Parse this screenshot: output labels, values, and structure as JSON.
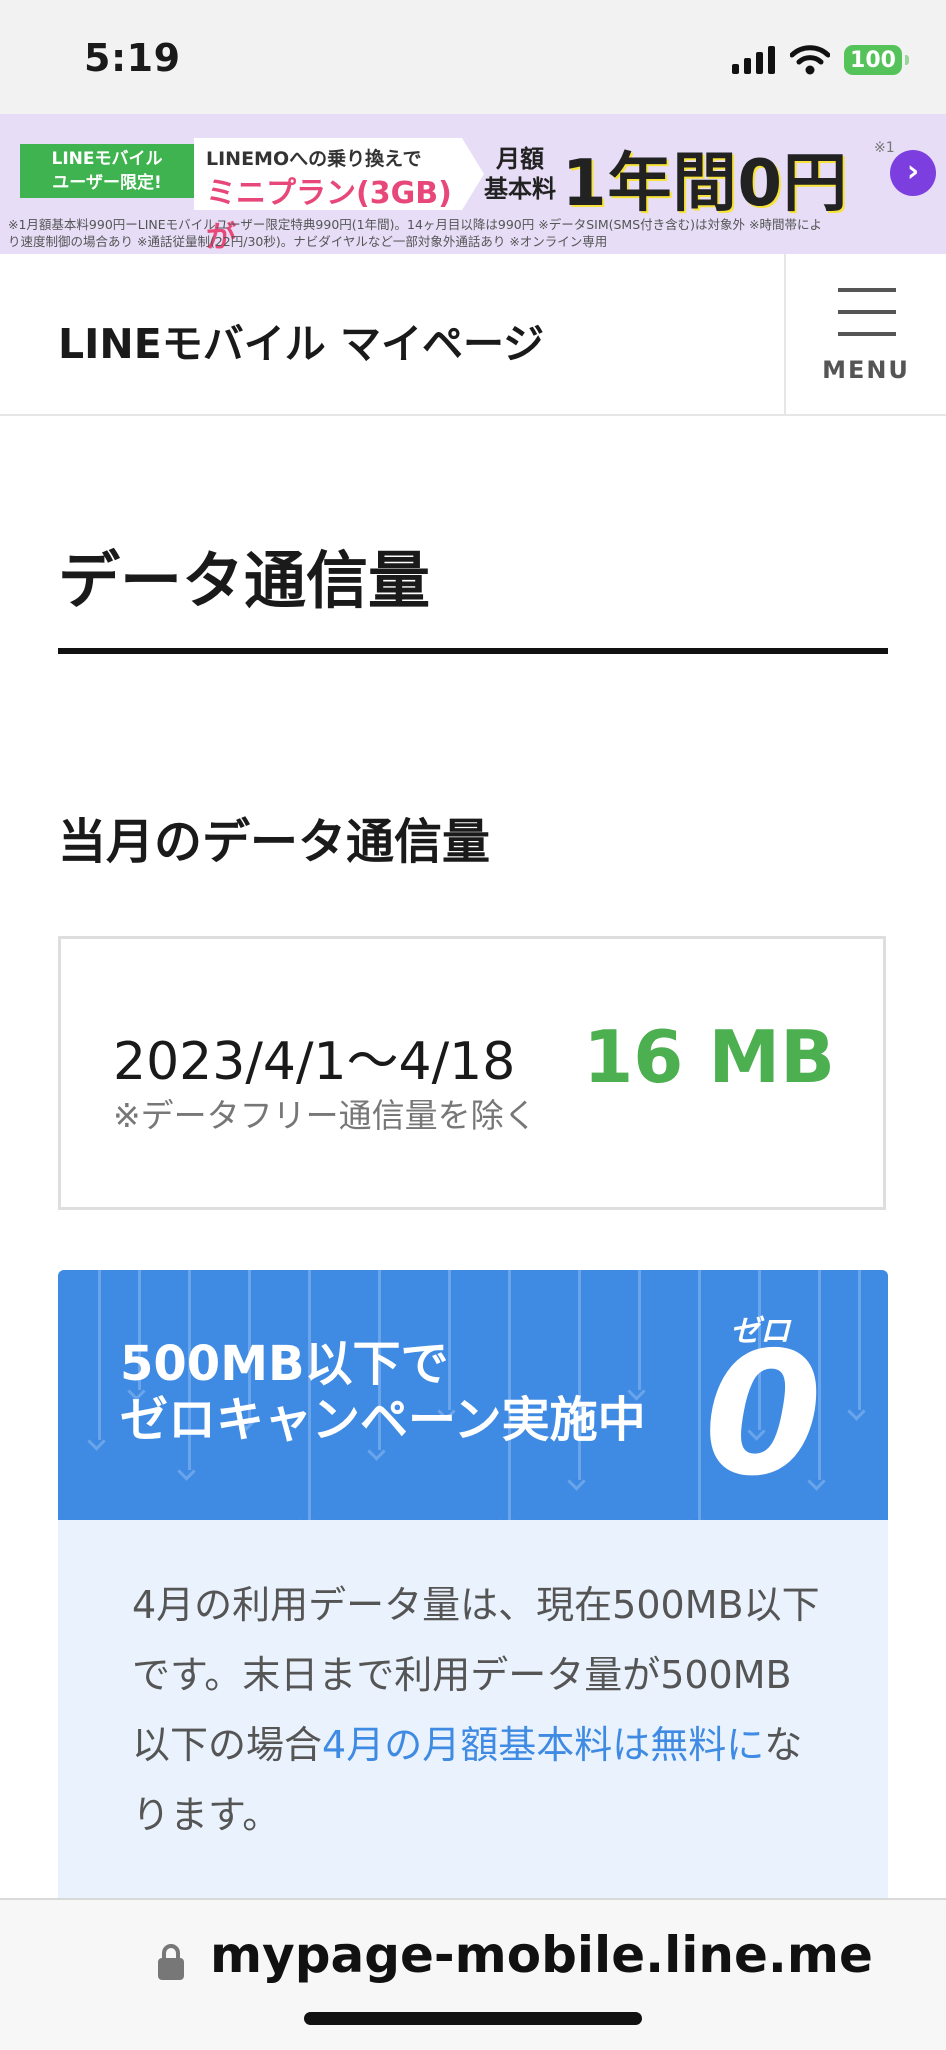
{
  "status_bar": {
    "time": "5:19",
    "battery": "100"
  },
  "banner": {
    "badge_line1": "LINEモバイル",
    "badge_line2": "ユーザー限定!",
    "mid_line1": "LINEMOへの乗り換えで",
    "mid_line2": "ミニプラン(3GB)が",
    "monthly_line1": "月額",
    "monthly_line2": "基本料",
    "headline": "1年間0円",
    "footnote_mark": "※1",
    "fine_line1": "※1月額基本料990円ーLINEモバイルユーザー限定特典990円(1年間)。14ヶ月目以降は990円 ※データSIM(SMS付き含む)は対象外 ※時間帯によ",
    "fine_line2": "り速度制御の場合あり ※通話従量制(22円/30秒)。ナビダイヤルなど一部対象外通話あり ※オンライン専用",
    "accent_color": "#3fb34f"
  },
  "header": {
    "title": "LINEモバイル マイページ",
    "menu_label": "MENU"
  },
  "main": {
    "page_title": "データ通信量",
    "section_title": "当月のデータ通信量",
    "usage": {
      "period": "2023/4/1〜4/18",
      "note": "※データフリー通信量を除く",
      "value": "16 MB",
      "value_color": "#4caf50"
    },
    "campaign": {
      "line1": "500MB以下で",
      "line2": "ゼロキャンペーン実施中",
      "zero_ruby": "ゼロ",
      "zero": "0",
      "color": "#3f8ae2"
    },
    "campaign_body": {
      "text_before": "4月の利用データ量は、現在500MB以下です。末日まで利用データ量が500MB以下の場合",
      "highlight": "4月の月額基本料は無料に",
      "text_after": "なります。"
    }
  },
  "url_bar": {
    "url": "mypage-mobile.line.me"
  }
}
